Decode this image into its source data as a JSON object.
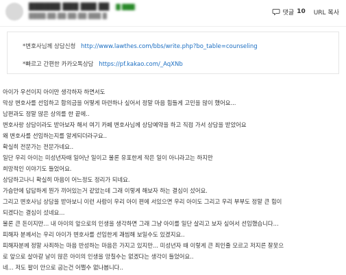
{
  "header": {
    "author": "██████ ███ ███ ██",
    "badge": "█ ███",
    "meta": "████.██.██ ██:██ ███ █",
    "comment_label": "댓글",
    "comment_count": "10",
    "url_copy_label": "URL 복사"
  },
  "links": [
    {
      "label": "*변호사님께 상담신청",
      "url": "http://www.lawthes.com/bbs/write.php?bo_table=counseling"
    },
    {
      "label": "*빠르고 간편한 카카오톡상담",
      "url": "https://pf.kakao.com/_AqXNb"
    }
  ],
  "body_lines": [
    "아이가 우선이지 아이만 생각하자 하면서도",
    "막상 변호사를 선임하고 합의금을 어떻게 마련하나 싶어서 정말 마음 힘들게 고민을 많이 했어요...",
    "남편과도 정말 많은 상의를 한 끝에..",
    "변호사랑 상담이라도 받아보자 해서 여기 카페 변호사님께 상담예약을 하고 직접 가서 상담을 받았어요",
    "왜 변호사를 선임하는지를 알게되더라구요..",
    "확실히 전문가는 전문가네요..",
    "일단 우리 아이는 미성년자때 일어난 일이고 물론 유포한게 작은 일이 아니라고는 하지만",
    "희망적인 이야기도 들었어요.",
    "상담하고나니 확실히 마음이 어느정도 정리가 되네요.",
    "가슴만에 답답하게 뭔가 끼어있는거 같았는데 그래 이렇게 해보자 하는 결심이 섰어요.",
    "그리고 변호사님 상담을 받아보니 이런 사람이 우리 아이 편에 서있으면 우리 아이도 그리고 우리 부부도 정말 큰 힘이",
    "되겠다는 결심이 섰네요...",
    "물론 큰 돈이지만... 내 아이의 앞으로의 인생을 생각하면 그래 그냥 아이를 일단 살리고 보자 싶어서 선임했습니다...",
    "피해자 분께서는 우리 아이가 변호사를 선임한게 괘씸해 보일수도 있겠지요..",
    "피해자분께 정말 사죄하는 마음 반성하는 마음은 가지고 있지만... 미성년자 때 이렇게 큰 죄인줄 모르고 저지른 잘못으",
    "로 앞으로 살아갈 날이 많은 아이의 인생을 망칠수는 없겠다는 생각이 들었어요..",
    "네... 저도 팔이 안으로 굽는건 어쩔수 없나봅니다.."
  ]
}
